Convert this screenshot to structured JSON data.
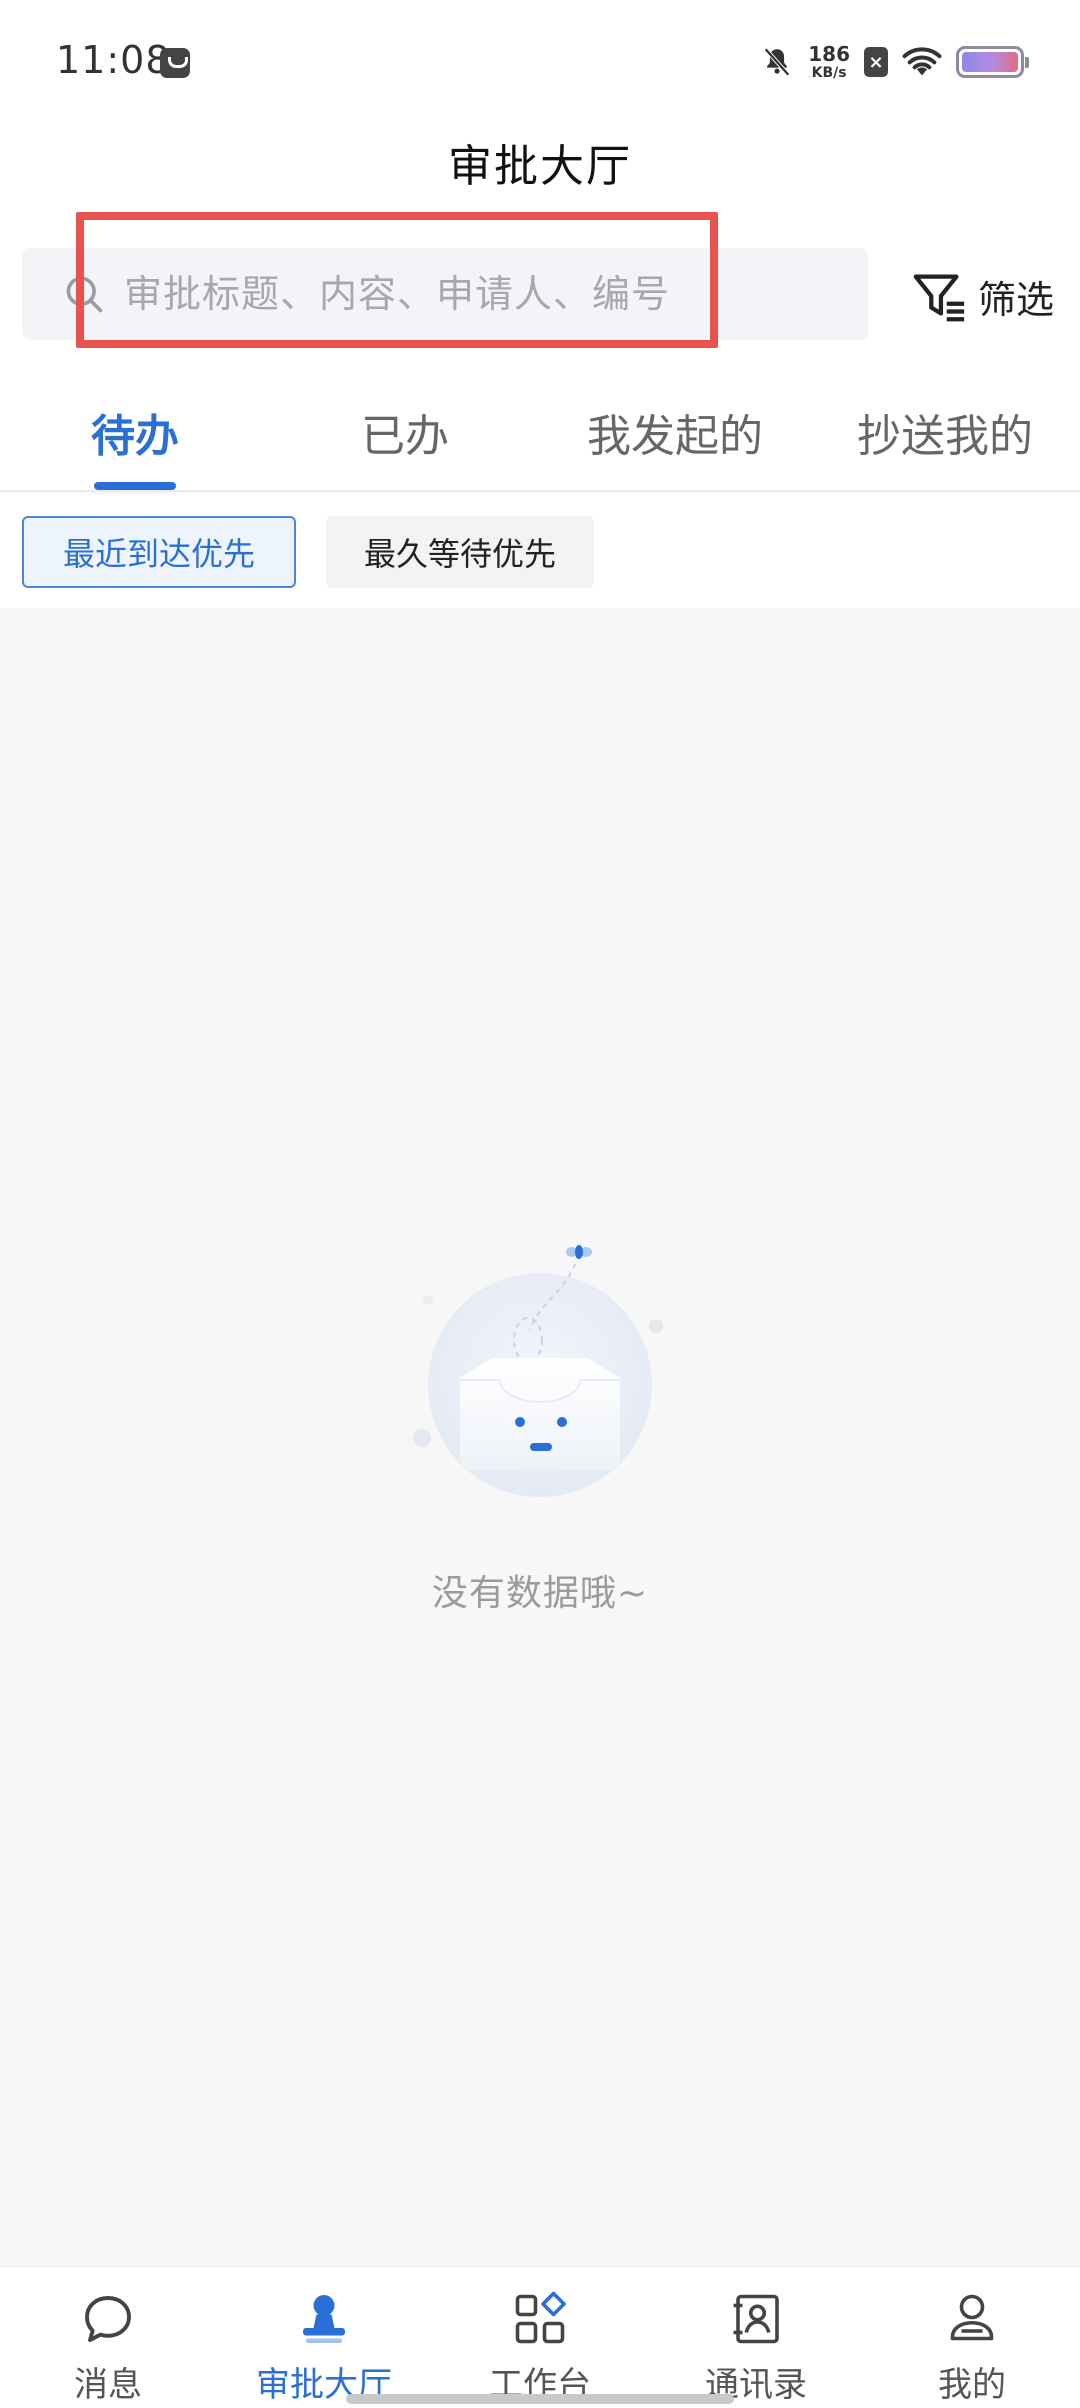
{
  "status_bar": {
    "time": "11:08",
    "net_speed_value": "186",
    "net_speed_unit": "KB/s"
  },
  "header": {
    "title": "审批大厅"
  },
  "search": {
    "placeholder": "审批标题、内容、申请人、编号",
    "value": ""
  },
  "filter": {
    "label": "筛选"
  },
  "tabs": [
    {
      "label": "待办",
      "active": true
    },
    {
      "label": "已办",
      "active": false
    },
    {
      "label": "我发起的",
      "active": false
    },
    {
      "label": "抄送我的",
      "active": false
    }
  ],
  "sort_chips": [
    {
      "label": "最近到达优先",
      "active": true
    },
    {
      "label": "最久等待优先",
      "active": false
    }
  ],
  "empty_state": {
    "text": "没有数据哦~"
  },
  "bottom_nav": [
    {
      "label": "消息",
      "icon": "chat-bubble-icon",
      "active": false
    },
    {
      "label": "审批大厅",
      "icon": "stamp-icon",
      "active": true
    },
    {
      "label": "工作台",
      "icon": "grid-apps-icon",
      "active": false
    },
    {
      "label": "通讯录",
      "icon": "contact-book-icon",
      "active": false
    },
    {
      "label": "我的",
      "icon": "person-icon",
      "active": false
    }
  ],
  "colors": {
    "accent": "#2a6fd6",
    "highlight_box": "#e8524f",
    "background": "#f7f7f7"
  }
}
